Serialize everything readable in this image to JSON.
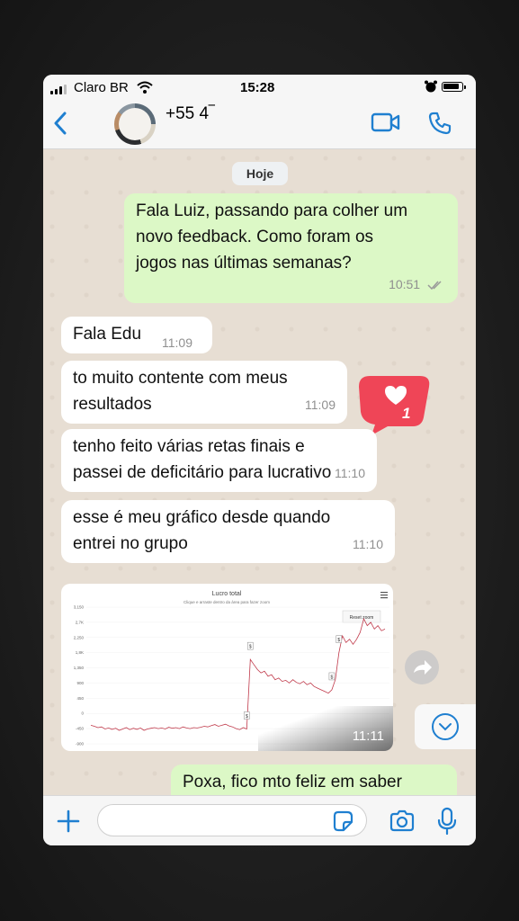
{
  "status_bar": {
    "carrier": "Claro BR",
    "time": "15:28"
  },
  "header": {
    "contact_name": "+55 4‾"
  },
  "chat": {
    "date_label": "Hoje",
    "messages": [
      {
        "direction": "out",
        "text_lines": [
          "Fala Luiz, passando para colher um",
          "novo feedback. Como foram os",
          "jogos nas últimas semanas?"
        ],
        "time": "10:51"
      },
      {
        "direction": "in",
        "text_lines": [
          "Fala Edu"
        ],
        "time": "11:09"
      },
      {
        "direction": "in",
        "text_lines": [
          "to muito contente com meus",
          "resultados"
        ],
        "time": "11:09"
      },
      {
        "direction": "in",
        "text_lines": [
          "tenho feito várias retas finais e",
          "passei de deficitário para lucrativo"
        ],
        "time": "11:10"
      },
      {
        "direction": "in",
        "text_lines": [
          "esse é meu gráfico desde quando",
          "entrei no grupo"
        ],
        "time": "11:10"
      },
      {
        "direction": "in",
        "type": "image",
        "time": "11:11"
      },
      {
        "direction": "out",
        "text_lines": [
          "Poxa, fico mto feliz em saber"
        ]
      }
    ],
    "reaction": {
      "count": "1",
      "icon": "heart-icon",
      "color": "#ef4557"
    }
  },
  "chart_data": {
    "type": "line",
    "title": "Lucro total",
    "subtitle": "Clique e arraste dentro da área para fazer zoom",
    "reset_label": "Reset zoom",
    "yticks": [
      "3,150",
      "2,7K",
      "2,250",
      "1,8K",
      "1,350",
      "900",
      "450",
      "0",
      "-450",
      "-900"
    ],
    "ylim": [
      -900,
      3150
    ],
    "series": [
      {
        "values": [
          -350,
          -380,
          -420,
          -400,
          -460,
          -430,
          -470,
          -440,
          -500,
          -460,
          -420,
          -480,
          -440,
          -470,
          -430,
          -500,
          -460,
          -440,
          -420,
          -450,
          -430,
          -460,
          -410,
          -440,
          -420,
          -450,
          -400,
          -430,
          -450,
          -420,
          -430,
          -410,
          -380,
          -400,
          -360,
          -330,
          -380,
          -350,
          -320,
          -370,
          -400,
          -450,
          -480,
          -420,
          -460,
          1600,
          1450,
          1300,
          1200,
          1250,
          1100,
          1150,
          1000,
          1050,
          950,
          980,
          900,
          1000,
          920,
          880,
          950,
          850,
          900,
          800,
          750,
          700,
          650,
          600,
          700,
          1000,
          1800,
          2300,
          2100,
          2200,
          2050,
          2200,
          2400,
          2800,
          2600,
          2700,
          2500,
          2600,
          2450,
          2500
        ]
      }
    ],
    "markers": [
      "$",
      "$",
      "$",
      "$"
    ]
  },
  "colors": {
    "ios_blue": "#1f7fd0",
    "outgoing_bubble": "#dcf8c6",
    "incoming_bubble": "#ffffff",
    "chat_bg": "#e7ded3"
  }
}
